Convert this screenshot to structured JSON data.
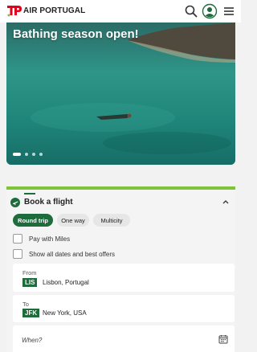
{
  "brand": {
    "name": "AIR PORTUGAL",
    "mark": "TP",
    "accent": "#1e6b3c",
    "brand_red": "#e2001a",
    "highlight": "#7fc33b"
  },
  "header": {
    "icons": [
      "search-icon",
      "account-icon",
      "hamburger-menu-icon"
    ]
  },
  "hero": {
    "title": "Bathing season open!",
    "slide_count": 4,
    "active_slide": 1
  },
  "booking": {
    "title": "Book a flight",
    "trip_types": [
      {
        "label": "Round trip",
        "selected": true
      },
      {
        "label": "One way",
        "selected": false
      },
      {
        "label": "Multicity",
        "selected": false
      }
    ],
    "pay_with_miles": {
      "label": "Pay with Miles",
      "checked": false
    },
    "show_all_dates": {
      "label": "Show all dates and best offers",
      "checked": false
    },
    "from": {
      "label": "From",
      "code": "LIS",
      "city": "Lisbon, Portugal"
    },
    "to": {
      "label": "To",
      "code": "JFK",
      "city": "New York, USA"
    },
    "when": {
      "placeholder": "When?"
    }
  }
}
